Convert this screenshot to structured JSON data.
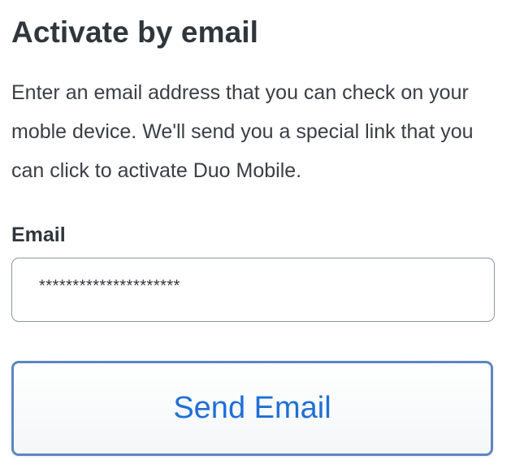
{
  "form": {
    "title": "Activate by email",
    "description": "Enter an email address that you can check on your moble device. We'll send you a special link that you can click to activate Duo Mobile.",
    "email_label": "Email",
    "email_value": "*********************",
    "send_label": "Send Email"
  },
  "colors": {
    "text": "#2f363c",
    "button_text": "#1f6fd6",
    "button_border": "#5d86c2",
    "input_border": "#8f959a"
  }
}
